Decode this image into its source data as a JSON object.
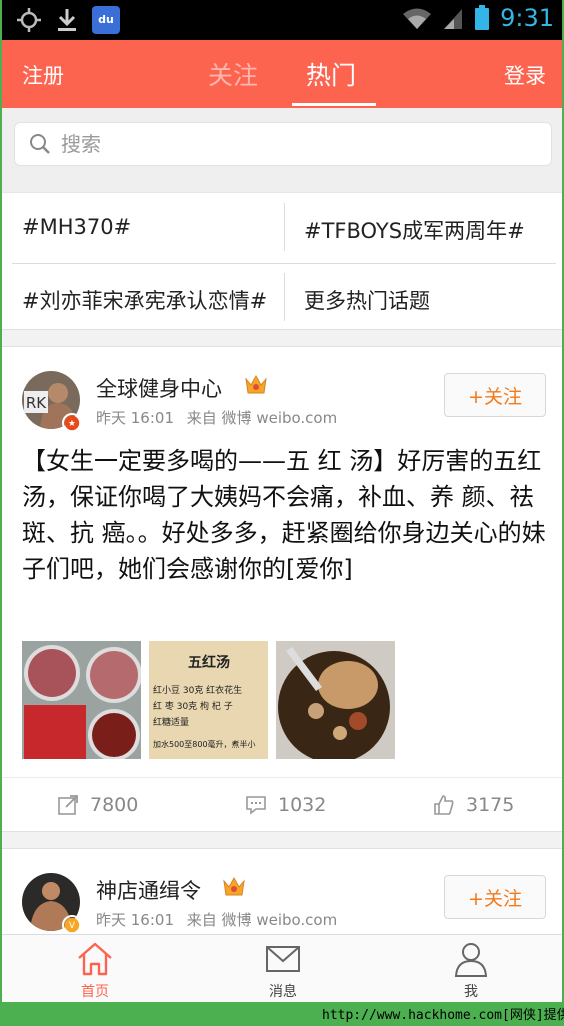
{
  "status_bar": {
    "time": "9:31",
    "baidu_icon_text": "du"
  },
  "header": {
    "register_label": "注册",
    "login_label": "登录",
    "tabs": [
      {
        "label": "关注",
        "active": false
      },
      {
        "label": "热门",
        "active": true
      }
    ],
    "accent_color": "#fd6450"
  },
  "search": {
    "placeholder": "搜索"
  },
  "hot_topics": [
    {
      "label": "#MH370#"
    },
    {
      "label": "#TFBOYS成军两周年#"
    },
    {
      "label": "#刘亦菲宋承宪承认恋情#"
    },
    {
      "label": "更多热门话题"
    }
  ],
  "posts": [
    {
      "username": "全球健身中心",
      "avatar_text": "RK",
      "time": "昨天 16:01",
      "source": "来自 微博 weibo.com",
      "follow_label": "+关注",
      "content": "【女生一定要多喝的——五 红 汤】好厉害的五红汤，保证你喝了大姨妈不会痛，补血、养 颜、祛 斑、抗 癌。。好处多多，赶紧圈给你身边关心的妹子们吧，她们会感谢你的[爱你]",
      "image_text": {
        "title": "五红汤",
        "lines": [
          "红小豆 30克  红衣花生",
          "红 枣 30克  枸 杞 子",
          "红糖适量",
          "加水500至800毫升，煮半小"
        ]
      },
      "reposts": "7800",
      "comments": "1032",
      "likes": "3175"
    },
    {
      "username": "神店通缉令",
      "time": "昨天 16:01",
      "source": "来自 微博 weibo.com",
      "follow_label": "+关注"
    }
  ],
  "bottom_nav": [
    {
      "label": "首页",
      "icon": "home-icon",
      "active": true
    },
    {
      "label": "消息",
      "icon": "mail-icon",
      "active": false
    },
    {
      "label": "我",
      "icon": "person-icon",
      "active": false
    }
  ],
  "watermark": "http://www.hackhome.com[网侠]提供"
}
